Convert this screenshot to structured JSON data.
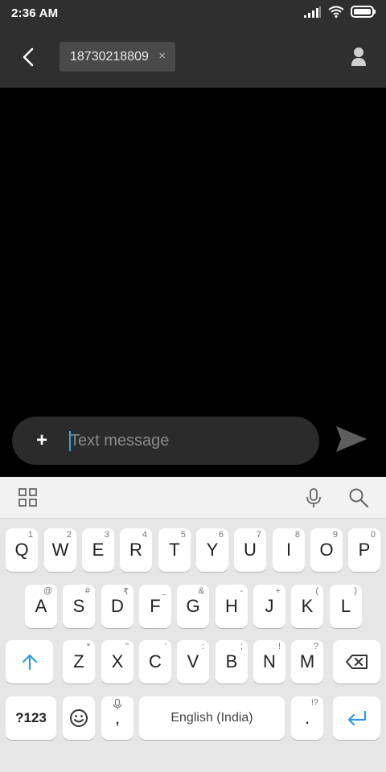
{
  "status_bar": {
    "time": "2:36 AM",
    "icons": [
      "signal-icon",
      "wifi-icon",
      "battery-icon"
    ]
  },
  "header": {
    "back_icon": "chevron-left-icon",
    "recipient": "18730218809",
    "remove_symbol": "×",
    "contact_icon": "person-icon"
  },
  "compose": {
    "add_symbol": "+",
    "placeholder": "Text message",
    "value": "",
    "send_icon": "send-icon"
  },
  "keyboard_toolbar": {
    "icons": [
      "grid-icon",
      "microphone-icon",
      "search-icon"
    ]
  },
  "keyboard": {
    "row1": [
      {
        "k": "Q",
        "h": "1"
      },
      {
        "k": "W",
        "h": "2"
      },
      {
        "k": "E",
        "h": "3"
      },
      {
        "k": "R",
        "h": "4"
      },
      {
        "k": "T",
        "h": "5"
      },
      {
        "k": "Y",
        "h": "6"
      },
      {
        "k": "U",
        "h": "7"
      },
      {
        "k": "I",
        "h": "8"
      },
      {
        "k": "O",
        "h": "9"
      },
      {
        "k": "P",
        "h": "0"
      }
    ],
    "row2": [
      {
        "k": "A",
        "h": "@"
      },
      {
        "k": "S",
        "h": "#"
      },
      {
        "k": "D",
        "h": "₹"
      },
      {
        "k": "F",
        "h": "_"
      },
      {
        "k": "G",
        "h": "&"
      },
      {
        "k": "H",
        "h": "-"
      },
      {
        "k": "J",
        "h": "+"
      },
      {
        "k": "K",
        "h": "("
      },
      {
        "k": "L",
        "h": ")"
      }
    ],
    "row3": [
      {
        "k": "Z",
        "h": "*"
      },
      {
        "k": "X",
        "h": "\""
      },
      {
        "k": "C",
        "h": "'"
      },
      {
        "k": "V",
        "h": ":"
      },
      {
        "k": "B",
        "h": ";"
      },
      {
        "k": "N",
        "h": "!"
      },
      {
        "k": "M",
        "h": "?"
      }
    ],
    "symbols_label": "?123",
    "comma_label": ",",
    "space_label": "English (India)",
    "period_label": ".",
    "period_hint": "!?",
    "accent_color": "#2f9be3"
  }
}
